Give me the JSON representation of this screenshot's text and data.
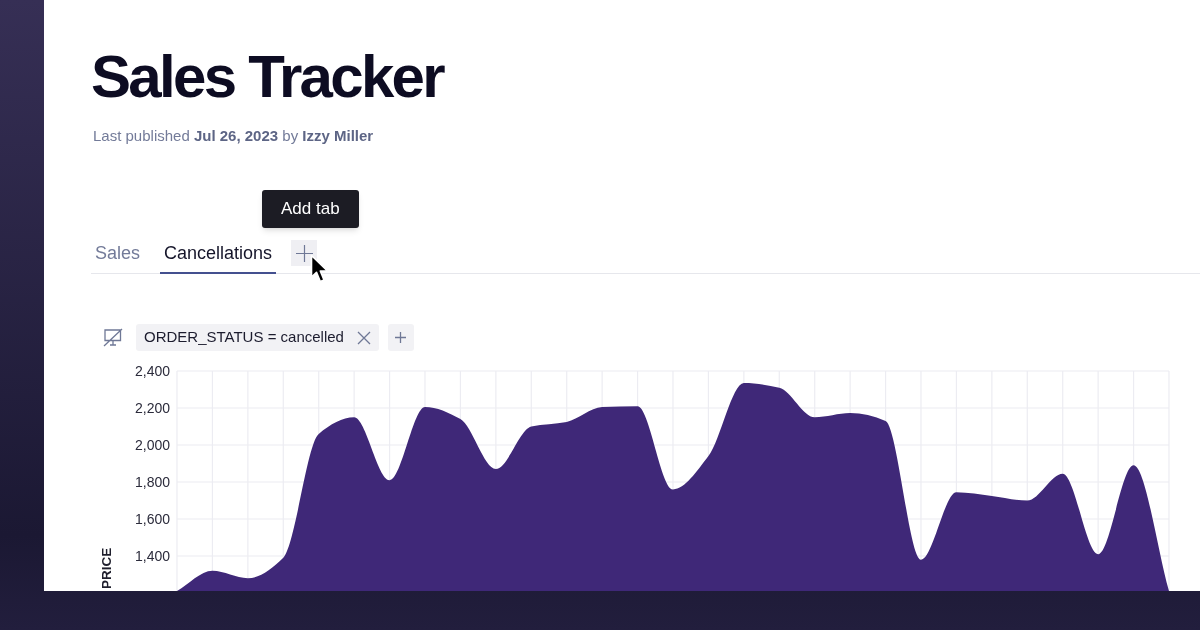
{
  "page": {
    "title": "Sales Tracker",
    "byline": "Last published **Jul 26, 2023** by **Izzy Miller**"
  },
  "tabs": [
    {
      "label": "Sales",
      "selected": false
    },
    {
      "label": "Cancellations",
      "selected": true
    }
  ],
  "add_tab_button": {
    "tooltip": "Add tab"
  },
  "filters": [
    {
      "label": "ORDER_STATUS = cancelled"
    }
  ],
  "chart": {
    "chart_data": {
      "type": "area",
      "ylabel": "PRICE",
      "grid": true,
      "ylim": [
        1200,
        2400
      ],
      "yticks": [
        {
          "value": 1400,
          "label": "1,400"
        },
        {
          "value": 1600,
          "label": "1,600"
        },
        {
          "value": 1800,
          "label": "1,800"
        },
        {
          "value": 2000,
          "label": "2,000"
        },
        {
          "value": 2200,
          "label": "2,200"
        },
        {
          "value": 2400,
          "label": "2,400"
        }
      ],
      "values": [
        1210,
        1320,
        1280,
        1390,
        2060,
        2150,
        1810,
        2205,
        2140,
        1870,
        2100,
        2125,
        2205,
        2210,
        1760,
        1940,
        2335,
        2310,
        2150,
        2173,
        2130,
        1380,
        1745,
        1725,
        1700,
        1845,
        1410,
        1890,
        1210
      ]
    }
  }
}
